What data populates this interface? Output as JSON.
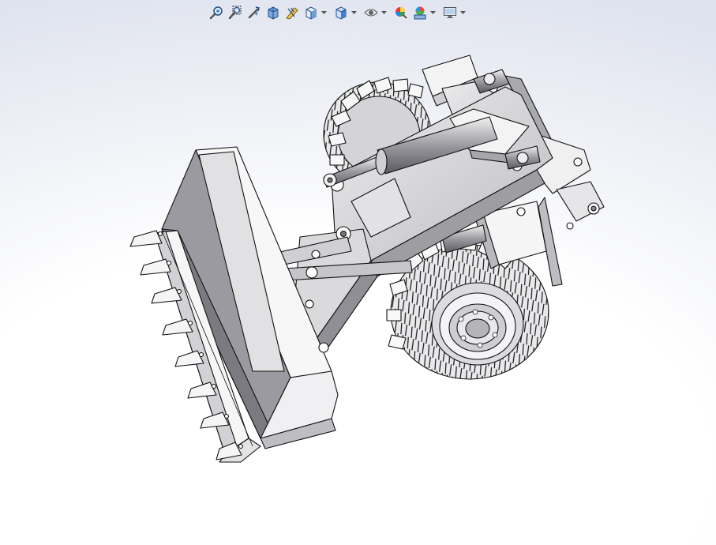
{
  "app": {
    "name": "3D CAD viewport",
    "view": "isometric"
  },
  "colors": {
    "background_top": "#dfe3ee",
    "background_bottom": "#ffffff",
    "model_fill_light": "#f4f4f4",
    "model_fill_mid": "#cfcfd2",
    "model_fill_dark": "#8e8e94",
    "edge": "#111111",
    "accent_blue": "#2a6fc9"
  },
  "toolbar": {
    "items": [
      {
        "id": "zoom-to-fit",
        "icon": "zoom-to-fit-icon",
        "has_dropdown": false
      },
      {
        "id": "zoom-to-area",
        "icon": "zoom-to-area-icon",
        "has_dropdown": false
      },
      {
        "id": "previous-view",
        "icon": "previous-view-icon",
        "has_dropdown": false
      },
      {
        "id": "section-view",
        "icon": "section-view-icon",
        "has_dropdown": false
      },
      {
        "id": "dynamic-annotation-views",
        "icon": "dynamic-annotation-icon",
        "has_dropdown": false
      },
      {
        "id": "view-orientation",
        "icon": "view-orientation-cube-icon",
        "has_dropdown": true
      },
      {
        "id": "display-style",
        "icon": "display-style-shaded-icon",
        "has_dropdown": true
      },
      {
        "id": "hide-show-items",
        "icon": "eye-icon",
        "has_dropdown": true
      },
      {
        "id": "edit-appearance",
        "icon": "appearance-sphere-icon",
        "has_dropdown": false
      },
      {
        "id": "apply-scene",
        "icon": "scene-icon",
        "has_dropdown": true
      },
      {
        "id": "view-settings",
        "icon": "monitor-icon",
        "has_dropdown": true
      }
    ]
  },
  "model": {
    "description_visible": false,
    "parts": [
      "bucket",
      "bucket-teeth",
      "lift-arm",
      "hydraulic-cylinder",
      "tilt-linkage",
      "front-frame",
      "wheel-rear-left",
      "wheel-front-right",
      "hub"
    ]
  }
}
